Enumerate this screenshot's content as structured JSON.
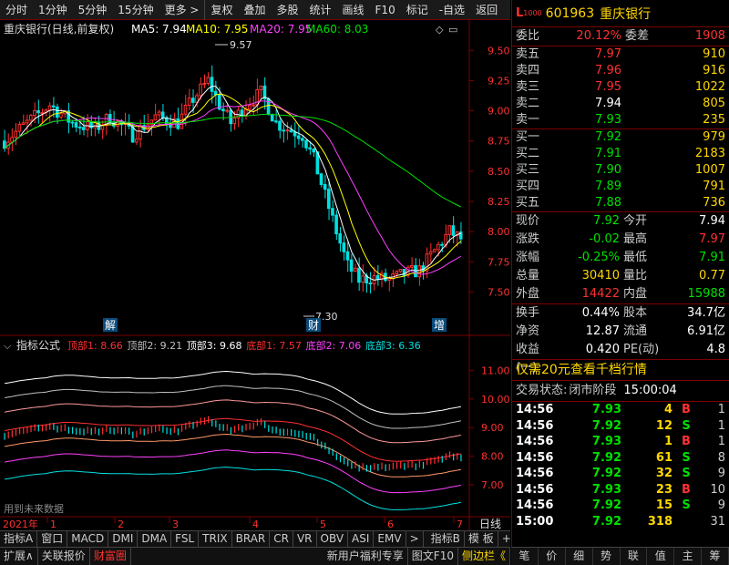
{
  "toolbar": {
    "items": [
      "分时",
      "1分钟",
      "5分钟",
      "15分钟",
      "更多",
      "复权",
      "叠加",
      "多股",
      "统计",
      "画线",
      "F10",
      "标记",
      "-自选",
      "返回"
    ]
  },
  "main_header": {
    "title": "重庆银行(日线,前复权)",
    "ma5": "MA5: 7.94",
    "ma10": "MA10: 7.95",
    "ma20": "MA20: 7.95",
    "ma60": "MA60: 8.03"
  },
  "colors": {
    "up": "#ff3030",
    "down": "#00e0e0",
    "ma5": "#ffffff",
    "ma10": "#ffff00",
    "ma20": "#ff40ff",
    "ma60": "#00e000",
    "border": "#7a0000"
  },
  "main_axis": {
    "labels": [
      "9.50",
      "9.25",
      "9.00",
      "8.75",
      "8.50",
      "8.25",
      "8.00",
      "7.75",
      "7.50"
    ]
  },
  "annotations": {
    "high": "9.57",
    "low": "7.30",
    "mark_jie": "解",
    "mark_cai": "财",
    "mark_zeng": "增"
  },
  "indicator": {
    "title": "指标公式",
    "items": [
      {
        "label": "顶部1: 8.66",
        "color": "#ff3030"
      },
      {
        "label": "顶部2: 9.21",
        "color": "#c0c0c0"
      },
      {
        "label": "顶部3: 9.68",
        "color": "#ffffff"
      },
      {
        "label": "底部1: 7.57",
        "color": "#ff3030"
      },
      {
        "label": "底部2: 7.06",
        "color": "#ff40ff"
      },
      {
        "label": "底部3: 6.36",
        "color": "#00e0e0"
      }
    ],
    "axis": [
      "11.00",
      "10.00",
      "9.00",
      "8.00",
      "7.00"
    ],
    "note": "用到未来数据"
  },
  "time_axis": {
    "year": "2021年",
    "months": [
      "1",
      "2",
      "3",
      "4",
      "5",
      "6",
      "7"
    ],
    "period": "日线"
  },
  "tabs1": [
    "指标A",
    "窗口",
    "MACD",
    "DMI",
    "DMA",
    "FSL",
    "TRIX",
    "BRAR",
    "CR",
    "VR",
    "OBV",
    "ASI",
    "EMV",
    ">",
    "指标B",
    "模 板",
    "+",
    "-"
  ],
  "tabs2": [
    "扩展∧",
    "关联报价",
    "财富圈"
  ],
  "tabs2_right": [
    "新用户福利专享",
    "图文F10",
    "侧边栏《"
  ],
  "stock": {
    "badge": "L",
    "badge_sub": "1000",
    "code": "601963",
    "name": "重庆银行"
  },
  "weibi": {
    "label": "委比",
    "value": "20.12%",
    "label2": "委差",
    "value2": "1908"
  },
  "asks": [
    {
      "label": "卖五",
      "price": "7.97",
      "vol": "910",
      "pc": "red"
    },
    {
      "label": "卖四",
      "price": "7.96",
      "vol": "916",
      "pc": "red"
    },
    {
      "label": "卖三",
      "price": "7.95",
      "vol": "1022",
      "pc": "red"
    },
    {
      "label": "卖二",
      "price": "7.94",
      "vol": "805",
      "pc": "white"
    },
    {
      "label": "卖一",
      "price": "7.93",
      "vol": "235",
      "pc": "green"
    }
  ],
  "bids": [
    {
      "label": "买一",
      "price": "7.92",
      "vol": "979",
      "pc": "green"
    },
    {
      "label": "买二",
      "price": "7.91",
      "vol": "2183",
      "pc": "green"
    },
    {
      "label": "买三",
      "price": "7.90",
      "vol": "1007",
      "pc": "green"
    },
    {
      "label": "买四",
      "price": "7.89",
      "vol": "791",
      "pc": "green"
    },
    {
      "label": "买五",
      "price": "7.88",
      "vol": "736",
      "pc": "green"
    }
  ],
  "quote": [
    {
      "a": "现价",
      "b": "7.92",
      "bc": "green",
      "c": "今开",
      "d": "7.94",
      "dc": "white"
    },
    {
      "a": "涨跌",
      "b": "-0.02",
      "bc": "green",
      "c": "最高",
      "d": "7.97",
      "dc": "red"
    },
    {
      "a": "涨幅",
      "b": "-0.25%",
      "bc": "green",
      "c": "最低",
      "d": "7.91",
      "dc": "green"
    },
    {
      "a": "总量",
      "b": "30410",
      "bc": "yellow",
      "c": "量比",
      "d": "0.77",
      "dc": "yellow"
    },
    {
      "a": "外盘",
      "b": "14422",
      "bc": "red",
      "c": "内盘",
      "d": "15988",
      "dc": "green"
    }
  ],
  "fund": [
    {
      "a": "换手",
      "b": "0.44%",
      "c": "股本",
      "d": "34.7亿"
    },
    {
      "a": "净资",
      "b": "12.87",
      "c": "流通",
      "d": "6.91亿"
    },
    {
      "a": "收益(一)",
      "b": "0.420",
      "c": "PE(动)",
      "d": "4.8"
    }
  ],
  "promo": "仅需20元查看千档行情",
  "trade_status": {
    "label": "交易状态:",
    "value": "闭市阶段",
    "time": "15:00:04"
  },
  "ticks": [
    {
      "t": "14:56",
      "p": "7.93",
      "pc": "green",
      "v": "4",
      "bs": "B",
      "bc": "red",
      "n": "1"
    },
    {
      "t": "14:56",
      "p": "7.92",
      "pc": "green",
      "v": "12",
      "bs": "S",
      "bc": "green",
      "n": "1"
    },
    {
      "t": "14:56",
      "p": "7.93",
      "pc": "green",
      "v": "1",
      "bs": "B",
      "bc": "red",
      "n": "1"
    },
    {
      "t": "14:56",
      "p": "7.92",
      "pc": "green",
      "v": "61",
      "bs": "S",
      "bc": "green",
      "n": "8"
    },
    {
      "t": "14:56",
      "p": "7.92",
      "pc": "green",
      "v": "32",
      "bs": "S",
      "bc": "green",
      "n": "9"
    },
    {
      "t": "14:56",
      "p": "7.93",
      "pc": "green",
      "v": "23",
      "bs": "B",
      "bc": "red",
      "n": "10"
    },
    {
      "t": "14:56",
      "p": "7.92",
      "pc": "green",
      "v": "15",
      "bs": "S",
      "bc": "green",
      "n": "9"
    },
    {
      "t": "15:00",
      "p": "7.92",
      "pc": "green",
      "v": "318",
      "bs": "",
      "bc": "green",
      "n": "31"
    }
  ],
  "panel_foot": [
    "笔",
    "价",
    "细",
    "势",
    "联",
    "值",
    "主",
    "筹"
  ]
}
